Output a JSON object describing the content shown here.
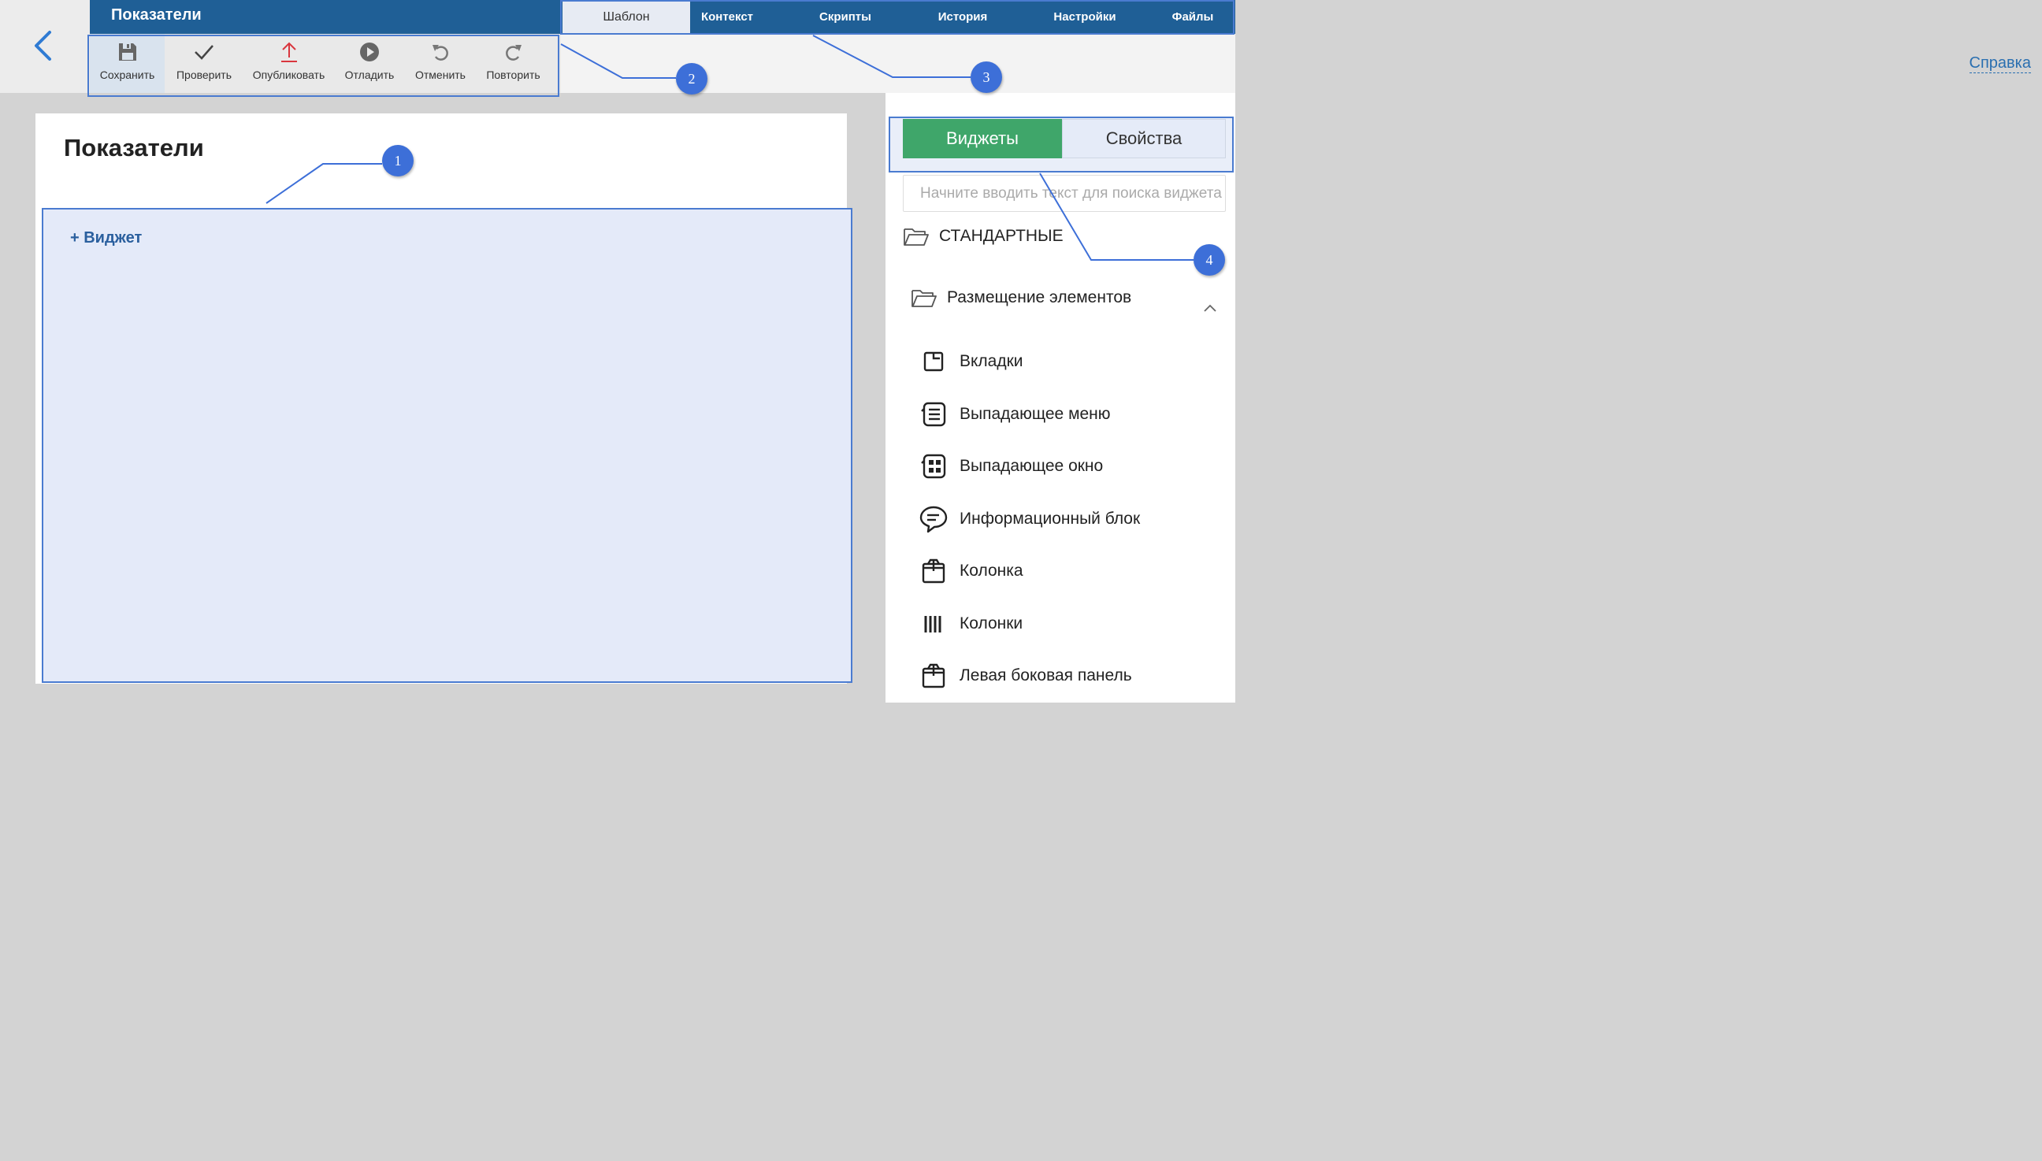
{
  "app": {
    "title": "Показатели"
  },
  "toolbar": {
    "items": [
      {
        "label": "Сохранить",
        "icon": "save-icon"
      },
      {
        "label": "Проверить",
        "icon": "check-icon"
      },
      {
        "label": "Опубликовать",
        "icon": "publish-icon"
      },
      {
        "label": "Отладить",
        "icon": "debug-icon"
      },
      {
        "label": "Отменить",
        "icon": "undo-icon"
      },
      {
        "label": "Повторить",
        "icon": "redo-icon"
      }
    ]
  },
  "tabs": {
    "items": [
      {
        "label": "Шаблон"
      },
      {
        "label": "Контекст"
      },
      {
        "label": "Скрипты"
      },
      {
        "label": "История"
      },
      {
        "label": "Настройки"
      },
      {
        "label": "Файлы"
      }
    ],
    "active": "Шаблон"
  },
  "help_link": "Справка",
  "canvas": {
    "title": "Показатели",
    "add_widget": "+ Виджет"
  },
  "panel": {
    "segments": {
      "widgets": "Виджеты",
      "properties": "Свойства"
    },
    "search_placeholder": "Начните вводить текст для поиска виджета",
    "category": "СТАНДАРТНЫЕ",
    "subcategory": "Размещение элементов",
    "items": [
      {
        "label": "Вкладки",
        "icon": "tabs-icon"
      },
      {
        "label": "Выпадающее меню",
        "icon": "dropdown-menu-icon"
      },
      {
        "label": "Выпадающее окно",
        "icon": "dropdown-window-icon"
      },
      {
        "label": "Информационный блок",
        "icon": "info-block-icon"
      },
      {
        "label": "Колонка",
        "icon": "column-icon"
      },
      {
        "label": "Колонки",
        "icon": "columns-icon"
      },
      {
        "label": "Левая боковая панель",
        "icon": "left-sidebar-icon"
      }
    ]
  },
  "annotations": {
    "callouts": [
      "1",
      "2",
      "3",
      "4"
    ]
  },
  "colors": {
    "header_blue": "#1f5f96",
    "accent_green": "#3fa66a",
    "annotation_blue": "#3d6fd8",
    "publish_red": "#d9363e"
  }
}
